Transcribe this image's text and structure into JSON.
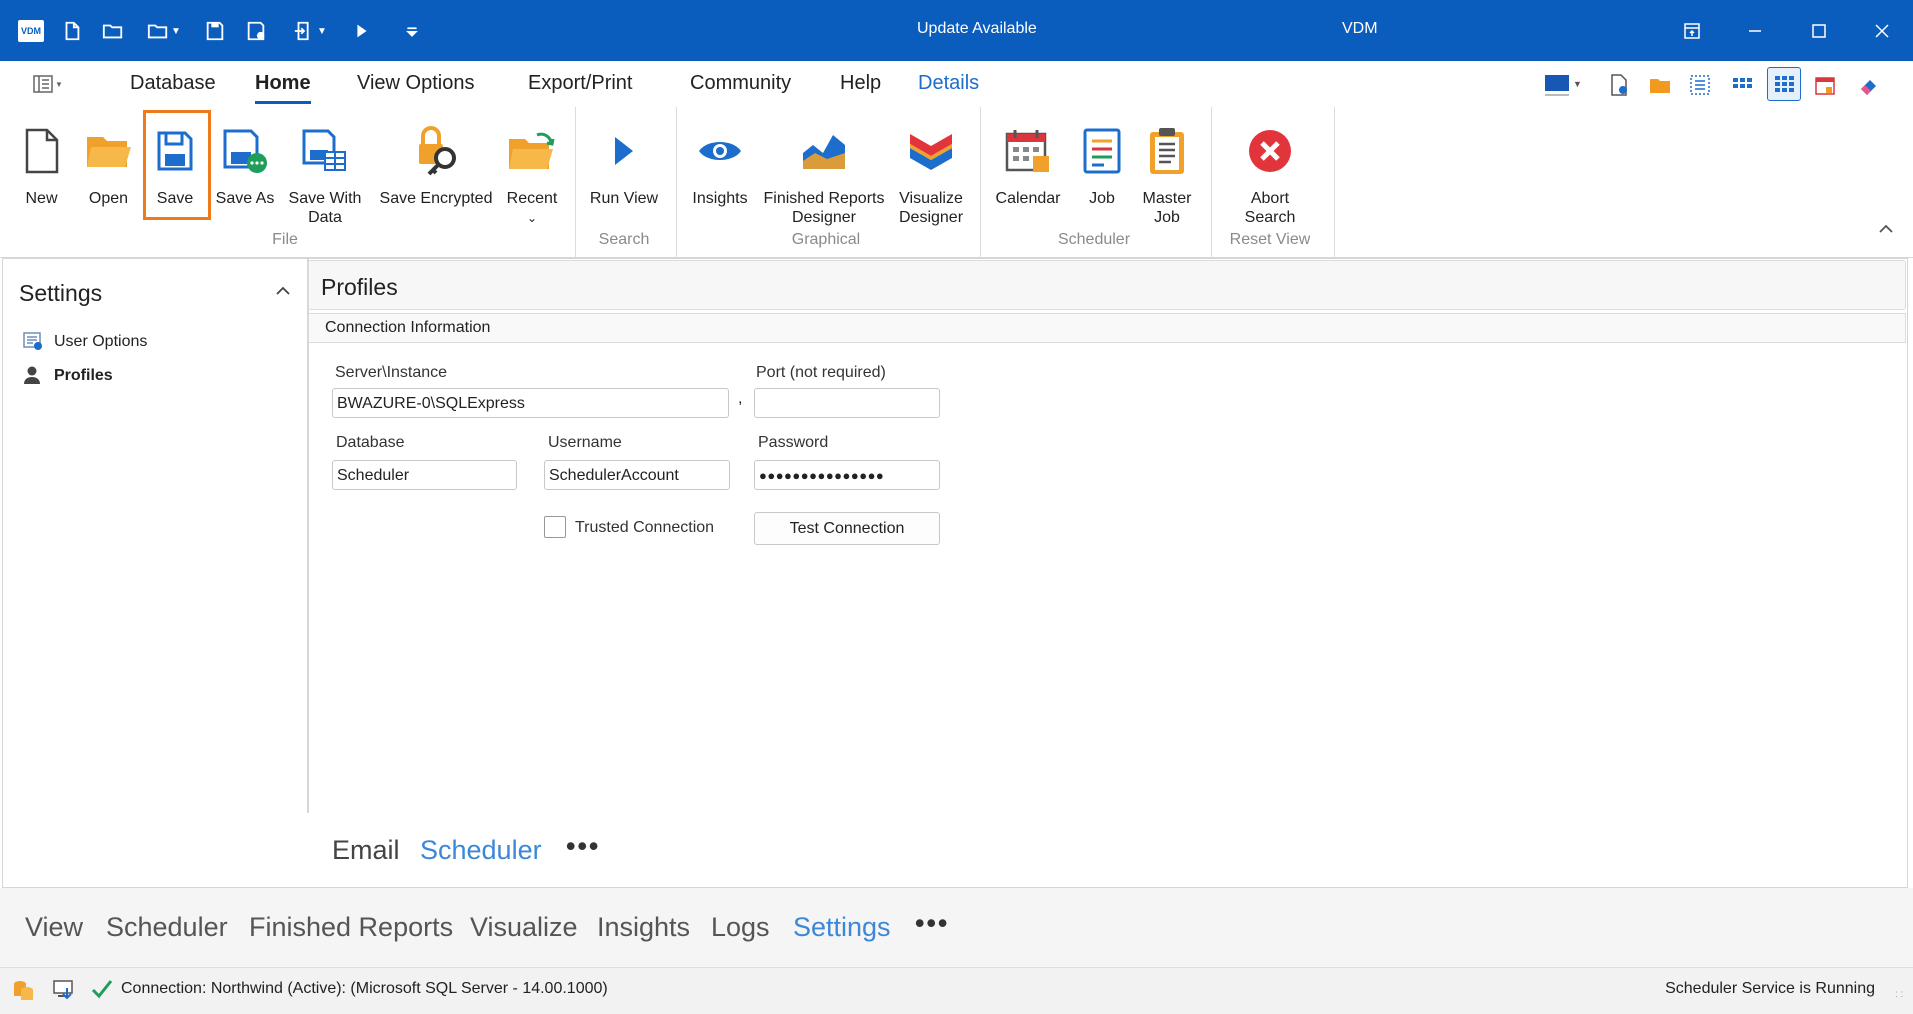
{
  "titlebar": {
    "logo_text": "VDM",
    "center_text": "Update Available",
    "app_title": "VDM"
  },
  "menu": {
    "tabs": [
      "Database",
      "Home",
      "View Options",
      "Export/Print",
      "Community",
      "Help",
      "Details"
    ]
  },
  "ribbon": {
    "buttons": {
      "new": "New",
      "open": "Open",
      "save": "Save",
      "save_as": "Save As",
      "save_with_data_1": "Save With",
      "save_with_data_2": "Data",
      "save_encrypted": "Save Encrypted",
      "recent": "Recent",
      "run_view": "Run View",
      "insights": "Insights",
      "frd_1": "Finished Reports",
      "frd_2": "Designer",
      "vd_1": "Visualize",
      "vd_2": "Designer",
      "calendar": "Calendar",
      "job": "Job",
      "master_1": "Master",
      "master_2": "Job",
      "abort_1": "Abort",
      "abort_2": "Search"
    },
    "groups": {
      "file": "File",
      "search": "Search",
      "graphical": "Graphical",
      "scheduler": "Scheduler",
      "reset_view": "Reset View"
    }
  },
  "settings": {
    "title": "Settings",
    "items": [
      {
        "label": "User Options",
        "icon": "user-options-icon",
        "selected": false
      },
      {
        "label": "Profiles",
        "icon": "person-icon",
        "selected": true
      }
    ]
  },
  "profiles": {
    "title": "Profiles",
    "section": "Connection Information",
    "server_label": "Server\\Instance",
    "server_value": "BWAZURE-0\\SQLExpress",
    "comma": ",",
    "port_label": "Port (not required)",
    "port_value": "",
    "database_label": "Database",
    "database_value": "Scheduler",
    "username_label": "Username",
    "username_value": "SchedulerAccount",
    "password_label": "Password",
    "password_value": "●●●●●●●●●●●●●●●",
    "trusted_label": "Trusted Connection",
    "trusted_checked": false,
    "test_button": "Test Connection"
  },
  "inner_tabs": {
    "tabs": [
      "Email",
      "Scheduler"
    ],
    "active": "Scheduler",
    "more": "•••"
  },
  "bottom_tabs": {
    "tabs": [
      "View",
      "Scheduler",
      "Finished Reports",
      "Visualize",
      "Insights",
      "Logs",
      "Settings"
    ],
    "active": "Settings",
    "more": "•••"
  },
  "status": {
    "connection": "Connection: Northwind (Active): (Microsoft SQL Server - 14.00.1000)",
    "service": "Scheduler Service is Running"
  },
  "colors": {
    "titlebar": "#0a5cbd",
    "accent_blue": "#1c6dcc",
    "highlight_orange": "#ef7a1a",
    "abort_red": "#e2343b"
  }
}
